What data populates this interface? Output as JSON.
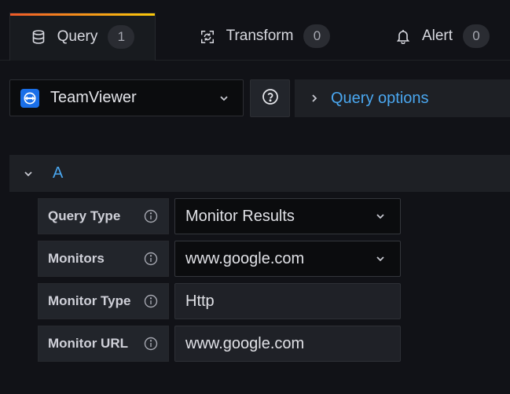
{
  "tabs": [
    {
      "label": "Query",
      "count": "1",
      "icon": "database-icon",
      "active": true
    },
    {
      "label": "Transform",
      "count": "0",
      "icon": "transform-icon",
      "active": false
    },
    {
      "label": "Alert",
      "count": "0",
      "icon": "bell-icon",
      "active": false
    }
  ],
  "datasource": {
    "name": "TeamViewer",
    "icon": "teamviewer-logo"
  },
  "query_options": {
    "label": "Query options"
  },
  "query_row": {
    "ref_id": "A"
  },
  "fields": [
    {
      "label": "Query Type",
      "value": "Monitor Results",
      "kind": "select"
    },
    {
      "label": "Monitors",
      "value": "www.google.com",
      "kind": "select"
    },
    {
      "label": "Monitor Type",
      "value": "Http",
      "kind": "input"
    },
    {
      "label": "Monitor URL",
      "value": "www.google.com",
      "kind": "input"
    }
  ],
  "colors": {
    "background": "#111217",
    "accent_blue": "#4aa7f0",
    "tab_gradient_start": "#f05a28",
    "tab_gradient_end": "#fbca0a",
    "teamviewer_blue": "#1a6fe8"
  }
}
